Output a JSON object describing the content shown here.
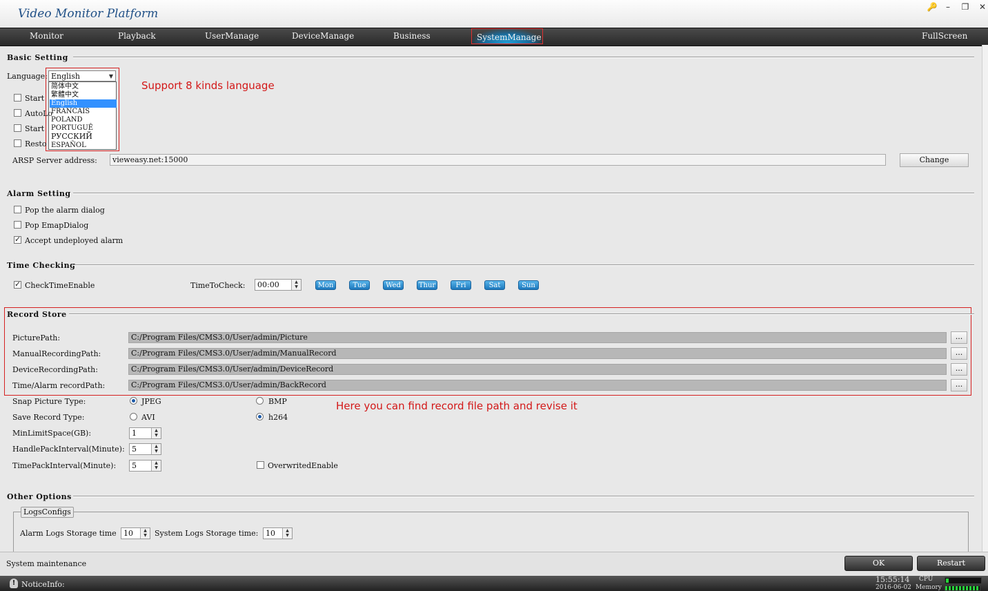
{
  "window": {
    "title": "Video Monitor Platform",
    "controls": [
      "🔑",
      "–",
      "❐",
      "✕"
    ]
  },
  "nav": {
    "items": [
      "Monitor",
      "Playback",
      "UserManage",
      "DeviceManage",
      "Business",
      "SystemManage"
    ],
    "active": "SystemManage",
    "fullscreen": "FullScreen"
  },
  "basic": {
    "heading": "Basic Setting",
    "language_label": "Language:",
    "language_value": "English",
    "language_options": [
      "简体中文",
      "繁體中文",
      "English",
      "FRANCAIS",
      "POLAND",
      "PORTUGUÊ",
      "РУССКИЙ",
      "ESPAÑOL"
    ],
    "checkboxes": [
      "Start",
      "AutoLo",
      "Start",
      "Resto"
    ],
    "arsp_label": "ARSP Server address:",
    "arsp_value": "vieweasy.net:15000",
    "change_button": "Change",
    "annotation": "Support 8 kinds language"
  },
  "alarm": {
    "heading": "Alarm Setting",
    "pop_alarm": "Pop the alarm dialog",
    "pop_emap": "Pop EmapDialog",
    "accept_undeployed": "Accept undeployed alarm"
  },
  "time_checking": {
    "heading": "Time Checking",
    "enable_label": "CheckTimeEnable",
    "time_label": "TimeToCheck:",
    "time_value": "00:00",
    "days": [
      "Mon",
      "Tue",
      "Wed",
      "Thur",
      "Fri",
      "Sat",
      "Sun"
    ]
  },
  "record": {
    "heading": "Record Store",
    "picture_label": "PicturePath:",
    "picture_path": "C:/Program Files/CMS3.0/User/admin/Picture",
    "manual_label": "ManualRecordingPath:",
    "manual_path": "C:/Program Files/CMS3.0/User/admin/ManualRecord",
    "device_label": "DeviceRecordingPath:",
    "device_path": "C:/Program Files/CMS3.0/User/admin/DeviceRecord",
    "alarm_label": "Time/Alarm recordPath:",
    "alarm_path": "C:/Program Files/CMS3.0/User/admin/BackRecord",
    "browse": "...",
    "snap_label": "Snap Picture Type:",
    "snap_jpeg": "JPEG",
    "snap_bmp": "BMP",
    "save_label": "Save Record Type:",
    "save_avi": "AVI",
    "save_h264": "h264",
    "min_space_label": "MinLimitSpace(GB):",
    "min_space": "1",
    "handle_label": "HandlePackInterval(Minute):",
    "handle": "5",
    "time_pack_label": "TimePackInterval(Minute):",
    "time_pack": "5",
    "overwrite_label": "OverwritedEnable",
    "annotation": "Here you can find record file path and revise it"
  },
  "other": {
    "heading": "Other Options",
    "logs_group": "LogsConfigs",
    "alarm_logs_label": "Alarm Logs Storage time",
    "alarm_logs": "10",
    "system_logs_label": "System Logs Storage time:",
    "system_logs": "10"
  },
  "footer": {
    "section_name": "System maintenance",
    "ok": "OK",
    "restart": "Restart",
    "notice": "NoticeInfo:",
    "time": "15:55:14",
    "date": "2016-06-02",
    "cpu_label": "CPU",
    "memory_label": "Memory"
  },
  "colors": {
    "accent": "#1a6d9e",
    "annotation": "#d31818",
    "meter": "#27d23a"
  }
}
